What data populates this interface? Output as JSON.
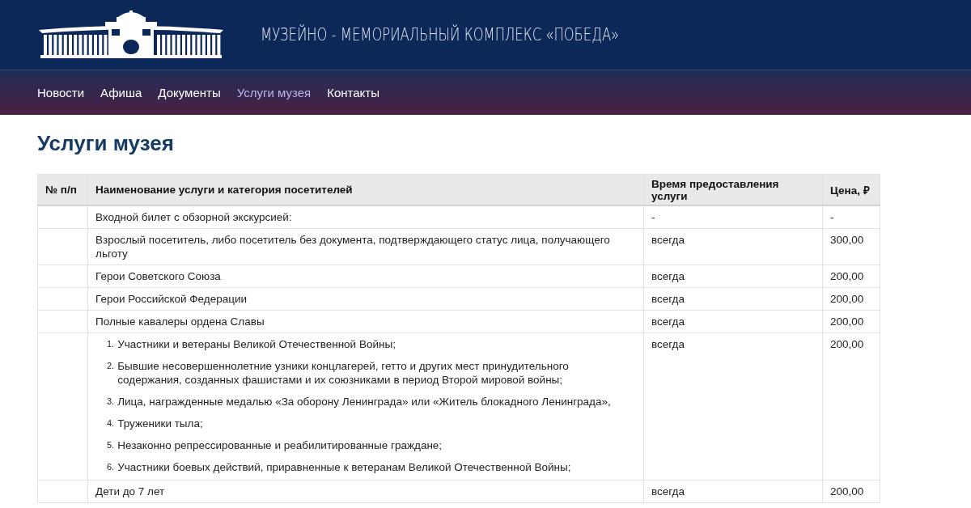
{
  "header": {
    "title": "МУЗЕЙНО - МЕМОРИАЛЬНЫЙ КОМПЛЕКС «ПОБЕДА»"
  },
  "nav": [
    {
      "label": "Новости",
      "selected": false
    },
    {
      "label": "Афиша",
      "selected": false
    },
    {
      "label": "Документы",
      "selected": false
    },
    {
      "label": "Услуги музея",
      "selected": true
    },
    {
      "label": "Контакты",
      "selected": false
    }
  ],
  "page_title": "Услуги музея",
  "table": {
    "columns": [
      "№ п/п",
      "Наименование услуги и категория посетителей",
      "Время предоставления услуги",
      "Цена, ₽"
    ],
    "rows": [
      {
        "kind": "text",
        "service": "Входной билет с обзорной экскурсией:",
        "time": "-",
        "price": "-"
      },
      {
        "kind": "text",
        "service": "Взрослый посетитель, либо посетитель без документа, подтверждающего статус лица, получающего льготу",
        "time": "всегда",
        "price": "300,00"
      },
      {
        "kind": "text",
        "service": "Герои Советского Союза",
        "time": "всегда",
        "price": "200,00"
      },
      {
        "kind": "text",
        "service": "Герои Российской Федерации",
        "time": "всегда",
        "price": "200,00"
      },
      {
        "kind": "text",
        "service": "Полные кавалеры ордена Славы",
        "time": "всегда",
        "price": "200,00"
      },
      {
        "kind": "list",
        "items": [
          {
            "marker": "1.",
            "text": "Участники и ветераны Великой Отечественной Войны;"
          },
          {
            "marker": "2.",
            "text": "Бывшие несовершеннолетние узники концлагерей, гетто и других мест принудительного содержания, созданных фашистами и их союзниками в период Второй мировой войны;"
          },
          {
            "marker": "3.",
            "text": "Лица, награжденные медалью «За оборону Ленинграда» или «Житель блокадного Ленинграда»,"
          },
          {
            "marker": "4.",
            "text": "Труженики тыла;"
          },
          {
            "marker": "5.",
            "text": "Незаконно репрессированные и реабилитированные граждане;"
          },
          {
            "marker": "6.",
            "text": "Участники боевых действий, приравненные к ветеранам Великой Отечественной Войны;"
          }
        ],
        "time": "всегда",
        "price": "200,00"
      },
      {
        "kind": "text",
        "service": "Дети до 7 лет",
        "time": "всегда",
        "price": "200,00"
      }
    ]
  }
}
